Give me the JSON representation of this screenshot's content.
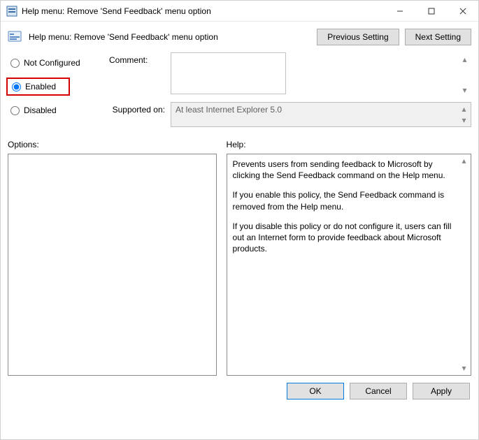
{
  "window": {
    "title": "Help menu: Remove 'Send Feedback' menu option"
  },
  "header": {
    "policy_title": "Help menu: Remove 'Send Feedback' menu option",
    "prev_btn": "Previous Setting",
    "next_btn": "Next Setting"
  },
  "radios": {
    "not_configured": "Not Configured",
    "enabled": "Enabled",
    "disabled": "Disabled",
    "selected": "enabled"
  },
  "fields": {
    "comment_label": "Comment:",
    "comment_value": "",
    "supported_label": "Supported on:",
    "supported_value": "At least Internet Explorer 5.0"
  },
  "panels": {
    "options_label": "Options:",
    "help_label": "Help:",
    "help_p1": "Prevents users from sending feedback to Microsoft by clicking the Send Feedback command on the Help menu.",
    "help_p2": "If you enable this policy, the Send Feedback command is removed from the Help menu.",
    "help_p3": "If you disable this policy or do not configure it, users can fill out an Internet form to provide feedback about Microsoft products."
  },
  "footer": {
    "ok": "OK",
    "cancel": "Cancel",
    "apply": "Apply"
  }
}
